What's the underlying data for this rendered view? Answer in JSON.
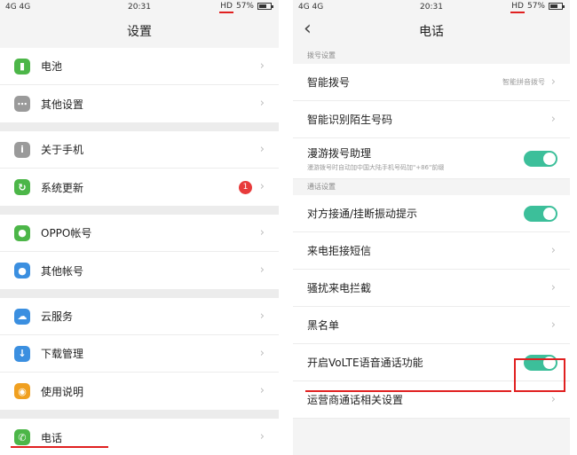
{
  "left": {
    "status": {
      "signal": "4G 4G",
      "time": "20:31",
      "hd": "HD",
      "battery": "57%"
    },
    "title": "设置",
    "groups": [
      [
        {
          "label": "电池",
          "icon": "battery-icon",
          "color": "#4cb648",
          "glyph": "▮"
        },
        {
          "label": "其他设置",
          "icon": "more-icon",
          "color": "#9a9a9a",
          "glyph": "⋯"
        }
      ],
      [
        {
          "label": "关于手机",
          "icon": "info-icon",
          "color": "#9a9a9a",
          "glyph": "i"
        },
        {
          "label": "系统更新",
          "icon": "update-icon",
          "color": "#4cb648",
          "glyph": "↻",
          "badge": "1"
        }
      ],
      [
        {
          "label": "OPPO帐号",
          "icon": "account-icon",
          "color": "#4cb648",
          "glyph": "●"
        },
        {
          "label": "其他帐号",
          "icon": "user-icon",
          "color": "#3b8fe0",
          "glyph": "●"
        }
      ],
      [
        {
          "label": "云服务",
          "icon": "cloud-icon",
          "color": "#3b8fe0",
          "glyph": "☁"
        },
        {
          "label": "下载管理",
          "icon": "download-icon",
          "color": "#3b8fe0",
          "glyph": "↓"
        },
        {
          "label": "使用说明",
          "icon": "help-icon",
          "color": "#f0a020",
          "glyph": "◉"
        }
      ],
      [
        {
          "label": "电话",
          "icon": "phone-icon",
          "color": "#4cb648",
          "glyph": "✆"
        }
      ]
    ]
  },
  "right": {
    "status": {
      "signal": "4G 4G",
      "time": "20:31",
      "hd": "HD",
      "battery": "57%"
    },
    "title": "电话",
    "sections": [
      {
        "header": "拨号设置",
        "items": [
          {
            "label": "智能拨号",
            "value": "智能拼音拨号",
            "type": "chevron"
          },
          {
            "label": "智能识别陌生号码",
            "type": "chevron"
          },
          {
            "label": "漫游拨号助理",
            "sub": "漫游拨号时自动加中国大陆手机号码加\"+86\"前缀",
            "type": "toggle"
          }
        ]
      },
      {
        "header": "通话设置",
        "items": [
          {
            "label": "对方接通/挂断振动提示",
            "type": "toggle"
          },
          {
            "label": "来电拒接短信",
            "type": "chevron"
          },
          {
            "label": "骚扰来电拦截",
            "type": "chevron"
          },
          {
            "label": "黑名单",
            "type": "chevron"
          },
          {
            "label": "开启VoLTE语音通话功能",
            "type": "toggle"
          },
          {
            "label": "运营商通话相关设置",
            "type": "chevron"
          }
        ]
      }
    ]
  },
  "colors": {
    "accent_green": "#3cbf9a",
    "highlight_red": "#e02020",
    "badge_red": "#e83b3b"
  }
}
